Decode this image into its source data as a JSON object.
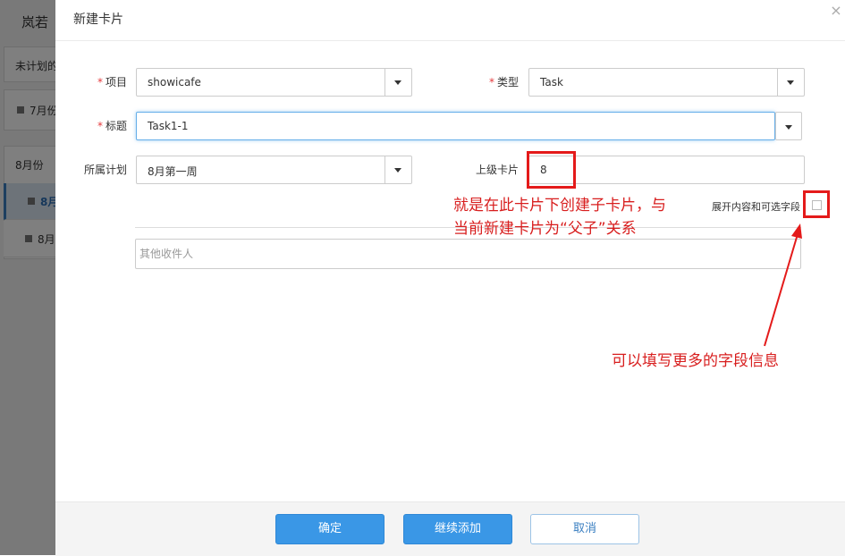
{
  "background": {
    "app_title": "岚若",
    "unplanned_label": "未计划的",
    "month_group_1": "7月份",
    "month_group_2": "8月份",
    "item_1": "8月",
    "item_2": "8月"
  },
  "modal": {
    "title": "新建卡片",
    "close_symbol": "×",
    "fields": {
      "project": {
        "label": "项目",
        "value": "showicafe",
        "required": true
      },
      "type": {
        "label": "类型",
        "value": "Task",
        "required": true
      },
      "title": {
        "label": "标题",
        "value": "Task1-1",
        "required": true
      },
      "plan": {
        "label": "所属计划",
        "value": "8月第一周"
      },
      "parent_card": {
        "label": "上级卡片",
        "value": "8"
      }
    },
    "required_mark": "*",
    "expand_label": "展开内容和可选字段",
    "expand_checked": false,
    "recipients_placeholder": "其他收件人",
    "buttons": {
      "confirm": "确定",
      "continue_add": "继续添加",
      "cancel": "取消"
    }
  },
  "annotations": {
    "parent_note_line1": "就是在此卡片下创建子卡片，与",
    "parent_note_line2": "当前新建卡片为“父子”关系",
    "fields_note": "可以填写更多的字段信息",
    "color": "#e41a1a"
  },
  "colors": {
    "primary": "#3a97e6",
    "overlay": "rgba(0,0,0,0.5)",
    "required": "#e4393c"
  }
}
